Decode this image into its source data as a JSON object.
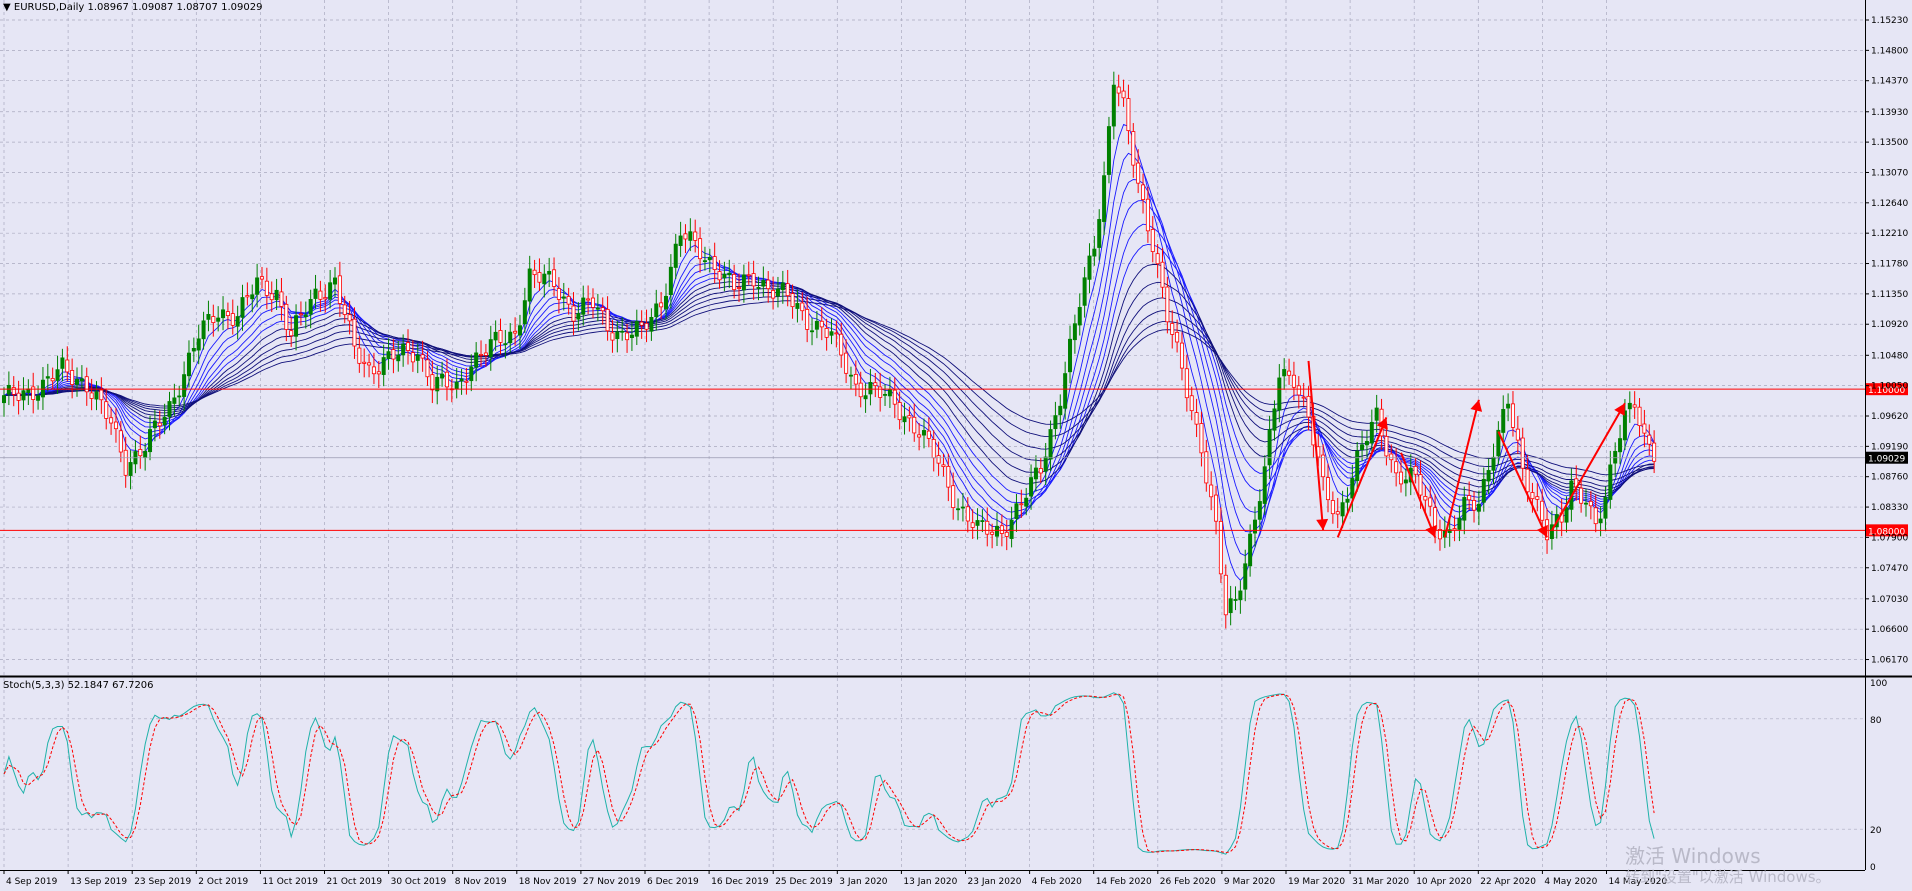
{
  "window": {
    "symbol_header": "▼ EURUSD,Daily  1.08967 1.09087 1.08707 1.09029"
  },
  "indicator": {
    "header": "Stoch(5,3,3) 52.1847 67.7206",
    "levels": [
      "100",
      "80",
      "20",
      "0"
    ]
  },
  "watermark": {
    "line1": "激活 Windows",
    "line2": "转到\"设置\"以激活 Windows。"
  },
  "colors": {
    "background": "#e6e6f5",
    "grid": "#a9a9bf",
    "bull_candle": "#008000",
    "bear_candle": "#ff0000",
    "ma_lines": "#0000c8",
    "level_line": "#ff0000",
    "stoch_main": "#20b2aa",
    "stoch_signal": "#ff0000"
  },
  "chart_data": [
    {
      "type": "candlestick",
      "symbol": "EURUSD",
      "timeframe": "Daily",
      "ohlc_last": {
        "open": 1.08967,
        "high": 1.09087,
        "low": 1.08707,
        "close": 1.09029
      },
      "price_ticks": [
        "1.15230",
        "1.14800",
        "1.14370",
        "1.13930",
        "1.13500",
        "1.13070",
        "1.12640",
        "1.12210",
        "1.11780",
        "1.11350",
        "1.10920",
        "1.10480",
        "1.10050",
        "1.09620",
        "1.09190",
        "1.08760",
        "1.08330",
        "1.07900",
        "1.07470",
        "1.07030",
        "1.06600",
        "1.06170"
      ],
      "ylim": [
        1.0605,
        1.154
      ],
      "horizontal_levels": [
        {
          "value": 1.1,
          "label": "1.10000"
        },
        {
          "value": 1.08,
          "label": "1.08000"
        }
      ],
      "current_price_label": "1.09029",
      "date_labels": [
        "4 Sep 2019",
        "13 Sep 2019",
        "23 Sep 2019",
        "2 Oct 2019",
        "11 Oct 2019",
        "21 Oct 2019",
        "30 Oct 2019",
        "8 Nov 2019",
        "18 Nov 2019",
        "27 Nov 2019",
        "6 Dec 2019",
        "16 Dec 2019",
        "25 Dec 2019",
        "3 Jan 2020",
        "13 Jan 2020",
        "23 Jan 2020",
        "4 Feb 2020",
        "14 Feb 2020",
        "26 Feb 2020",
        "9 Mar 2020",
        "19 Mar 2020",
        "31 Mar 2020",
        "10 Apr 2020",
        "22 Apr 2020",
        "4 May 2020",
        "14 May 2020"
      ],
      "close_path": [
        [
          0,
          1.0985
        ],
        [
          8,
          1.1005
        ],
        [
          12,
          1.1028
        ],
        [
          17,
          1.1008
        ],
        [
          22,
          1.095
        ],
        [
          25,
          1.0895
        ],
        [
          29,
          1.0918
        ],
        [
          34,
          1.0975
        ],
        [
          40,
          1.1075
        ],
        [
          44,
          1.111
        ],
        [
          48,
          1.1105
        ],
        [
          52,
          1.1148
        ],
        [
          56,
          1.1138
        ],
        [
          59,
          1.1075
        ],
        [
          64,
          1.1135
        ],
        [
          68,
          1.1152
        ],
        [
          72,
          1.1055
        ],
        [
          75,
          1.103
        ],
        [
          80,
          1.1045
        ],
        [
          85,
          1.1055
        ],
        [
          88,
          1.101
        ],
        [
          93,
          1.1
        ],
        [
          96,
          1.104
        ],
        [
          100,
          1.106
        ],
        [
          105,
          1.108
        ],
        [
          108,
          1.116
        ],
        [
          113,
          1.115
        ],
        [
          117,
          1.111
        ],
        [
          121,
          1.112
        ],
        [
          124,
          1.109
        ],
        [
          127,
          1.1078
        ],
        [
          131,
          1.108
        ],
        [
          135,
          1.1125
        ],
        [
          139,
          1.122
        ],
        [
          143,
          1.1195
        ],
        [
          147,
          1.117
        ],
        [
          150,
          1.114
        ],
        [
          154,
          1.116
        ],
        [
          158,
          1.114
        ],
        [
          161,
          1.113
        ],
        [
          165,
          1.11
        ],
        [
          170,
          1.1075
        ],
        [
          175,
          1.1005
        ],
        [
          178,
          1.1
        ],
        [
          183,
          1.098
        ],
        [
          188,
          1.094
        ],
        [
          192,
          1.0895
        ],
        [
          196,
          1.0835
        ],
        [
          200,
          1.08
        ],
        [
          205,
          1.08
        ],
        [
          209,
          1.0835
        ],
        [
          213,
          1.089
        ],
        [
          217,
          1.099
        ],
        [
          221,
          1.112
        ],
        [
          224,
          1.121
        ],
        [
          226,
          1.13
        ],
        [
          228,
          1.144
        ],
        [
          230,
          1.1395
        ],
        [
          233,
          1.129
        ],
        [
          236,
          1.121
        ],
        [
          239,
          1.11
        ],
        [
          243,
          1.1
        ],
        [
          246,
          1.092
        ],
        [
          249,
          1.08
        ],
        [
          251,
          1.068
        ],
        [
          253,
          1.07
        ],
        [
          256,
          1.079
        ],
        [
          259,
          1.088
        ],
        [
          262,
          1.102
        ],
        [
          265,
          1.102
        ],
        [
          268,
          1.096
        ],
        [
          271,
          1.086
        ],
        [
          274,
          1.082
        ],
        [
          278,
          1.09
        ],
        [
          282,
          1.096
        ],
        [
          286,
          1.088
        ],
        [
          290,
          1.087
        ],
        [
          294,
          1.081
        ],
        [
          297,
          1.0795
        ],
        [
          300,
          1.083
        ],
        [
          303,
          1.084
        ],
        [
          306,
          1.092
        ],
        [
          309,
          1.098
        ],
        [
          312,
          1.088
        ],
        [
          315,
          1.084
        ],
        [
          317,
          1.08
        ],
        [
          320,
          1.081
        ],
        [
          322,
          1.086
        ],
        [
          325,
          1.085
        ],
        [
          327,
          1.081
        ],
        [
          329,
          1.084
        ],
        [
          331,
          1.091
        ],
        [
          333,
          1.0965
        ],
        [
          335,
          1.099
        ],
        [
          337,
          1.093
        ],
        [
          339,
          1.0903
        ]
      ],
      "ma_ribbon_periods": [
        5,
        8,
        11,
        14,
        18,
        22,
        27,
        33,
        40,
        48,
        58,
        70
      ],
      "annotations": {
        "arrows": [
          {
            "from": [
              1.104
            ],
            "to": [
              1.08
            ],
            "direction": "down"
          },
          {
            "from": [
              1.079
            ],
            "to": [
              1.096
            ],
            "direction": "up"
          },
          {
            "from": [
              1.091
            ],
            "to": [
              1.079
            ],
            "direction": "down"
          },
          {
            "from": [
              1.079
            ],
            "to": [
              1.0985
            ],
            "direction": "up"
          },
          {
            "from": [
              1.094
            ],
            "to": [
              1.079
            ],
            "direction": "down"
          },
          {
            "from": [
              1.08
            ],
            "to": [
              1.098
            ],
            "direction": "up"
          }
        ]
      }
    },
    {
      "type": "line",
      "title": "Stoch(5,3,3) 52.1847 67.7206",
      "series": [
        {
          "name": "Main",
          "values": [
            52.1847
          ]
        },
        {
          "name": "Signal",
          "values": [
            67.7206
          ]
        }
      ],
      "levels": [
        100,
        80,
        20,
        0
      ],
      "ylim": [
        0,
        100
      ]
    }
  ]
}
